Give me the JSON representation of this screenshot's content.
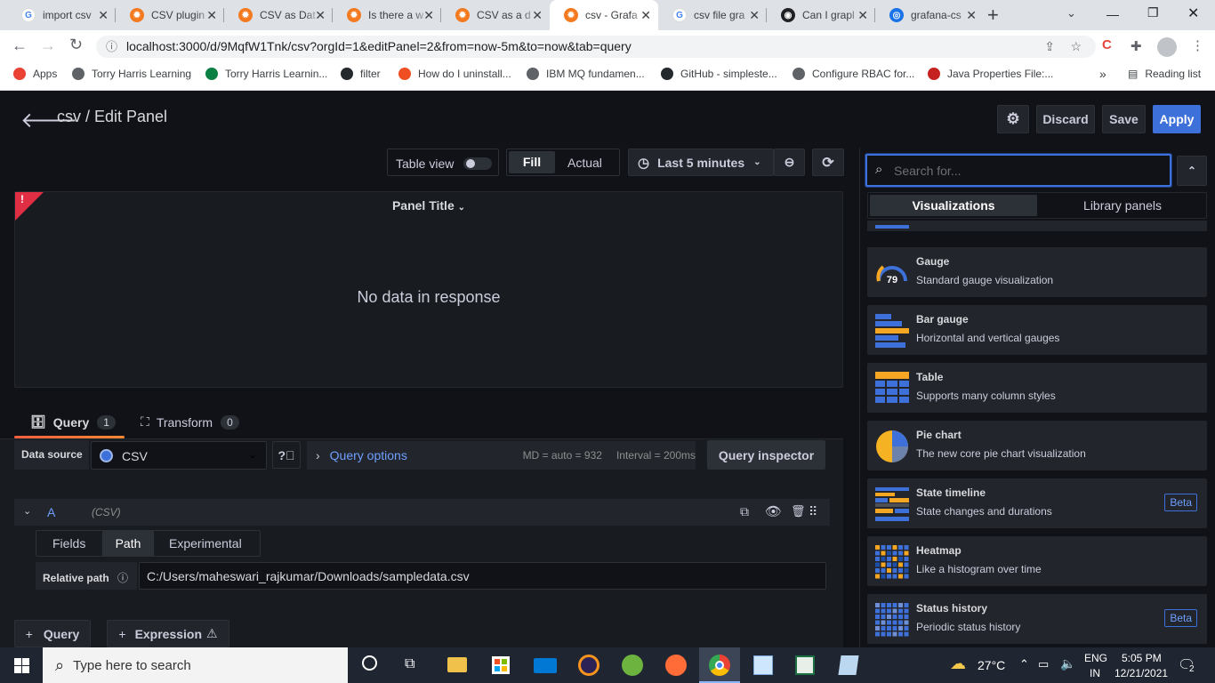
{
  "browser": {
    "tabs": [
      {
        "title": "import csv",
        "fav": "G",
        "kind": "g"
      },
      {
        "title": "CSV plugin",
        "fav": "✹",
        "kind": "gr"
      },
      {
        "title": "CSV as Dat",
        "fav": "✹",
        "kind": "gr"
      },
      {
        "title": "Is there a w",
        "fav": "✹",
        "kind": "gr"
      },
      {
        "title": "CSV as a d",
        "fav": "✹",
        "kind": "gr"
      },
      {
        "title": "csv - Grafa",
        "fav": "✹",
        "kind": "gr"
      },
      {
        "title": "csv file gra",
        "fav": "G",
        "kind": "g"
      },
      {
        "title": "Can I grapl",
        "fav": "◉",
        "kind": "gh"
      },
      {
        "title": "grafana-cs",
        "fav": "◎",
        "kind": "gc"
      }
    ],
    "new_tab": "+",
    "url": "localhost:3000/d/9MqfW1Tnk/csv?orgId=1&editPanel=2&from=now-5m&to=now&tab=query",
    "bookmarks": [
      {
        "label": "Apps",
        "color": "#ea4335"
      },
      {
        "label": "Torry Harris Learning",
        "color": "#5f6368"
      },
      {
        "label": "Torry Harris Learnin...",
        "color": "#0b8043"
      },
      {
        "label": "filter",
        "color": "#24292e"
      },
      {
        "label": "How do I uninstall...",
        "color": "#f04e23"
      },
      {
        "label": "IBM MQ fundamen...",
        "color": "#5f6368"
      },
      {
        "label": "GitHub - simpleste...",
        "color": "#24292e"
      },
      {
        "label": "Configure RBAC for...",
        "color": "#5f6368"
      },
      {
        "label": "Java Properties File:...",
        "color": "#c5221f"
      }
    ],
    "more": "»",
    "reading_list": "Reading list"
  },
  "header": {
    "title": "csv / Edit Panel",
    "discard": "Discard",
    "save": "Save",
    "apply": "Apply"
  },
  "toolbar": {
    "table_view": "Table view",
    "fill": "Fill",
    "actual": "Actual",
    "time_range": "Last 5 minutes"
  },
  "panel": {
    "title": "Panel Title",
    "empty": "No data in response",
    "alert": "!"
  },
  "tabs": {
    "query": "Query",
    "query_count": "1",
    "transform": "Transform",
    "transform_count": "0"
  },
  "query": {
    "data_source_label": "Data source",
    "data_source": "CSV",
    "query_options": "Query options",
    "md": "MD = auto = 932",
    "interval": "Interval = 200ms",
    "inspector": "Query inspector",
    "row_ref": "A",
    "row_type": "(CSV)",
    "subtabs": [
      "Fields",
      "Path",
      "Experimental"
    ],
    "relative_path_label": "Relative path",
    "relative_path": "C:/Users/maheswari_rajkumar/Downloads/sampledata.csv",
    "add_query": "Query",
    "add_expression": "Expression"
  },
  "viz_picker": {
    "search_placeholder": "Search for...",
    "tabs": [
      "Visualizations",
      "Library panels"
    ],
    "items": [
      {
        "name": "Gauge",
        "desc": "Standard gauge visualization",
        "icon": "gauge-icon",
        "badge": ""
      },
      {
        "name": "Bar gauge",
        "desc": "Horizontal and vertical gauges",
        "icon": "bar-gauge-icon",
        "badge": ""
      },
      {
        "name": "Table",
        "desc": "Supports many column styles",
        "icon": "table-icon",
        "badge": ""
      },
      {
        "name": "Pie chart",
        "desc": "The new core pie chart visualization",
        "icon": "pie-chart-icon",
        "badge": ""
      },
      {
        "name": "State timeline",
        "desc": "State changes and durations",
        "icon": "state-timeline-icon",
        "badge": "Beta"
      },
      {
        "name": "Heatmap",
        "desc": "Like a histogram over time",
        "icon": "heatmap-icon",
        "badge": ""
      },
      {
        "name": "Status history",
        "desc": "Periodic status history",
        "icon": "status-history-icon",
        "badge": "Beta"
      }
    ],
    "gauge_value": "79"
  },
  "taskbar": {
    "search": "Type here to search",
    "temp": "27°C",
    "lang1": "ENG",
    "lang2": "IN",
    "time": "5:05 PM",
    "date": "12/21/2021",
    "notif": "2"
  },
  "colors": {
    "accent": "#3d71d9",
    "panel_bg": "#181b1f",
    "page_bg": "#111217",
    "tab_underline": "#f55f3e"
  }
}
